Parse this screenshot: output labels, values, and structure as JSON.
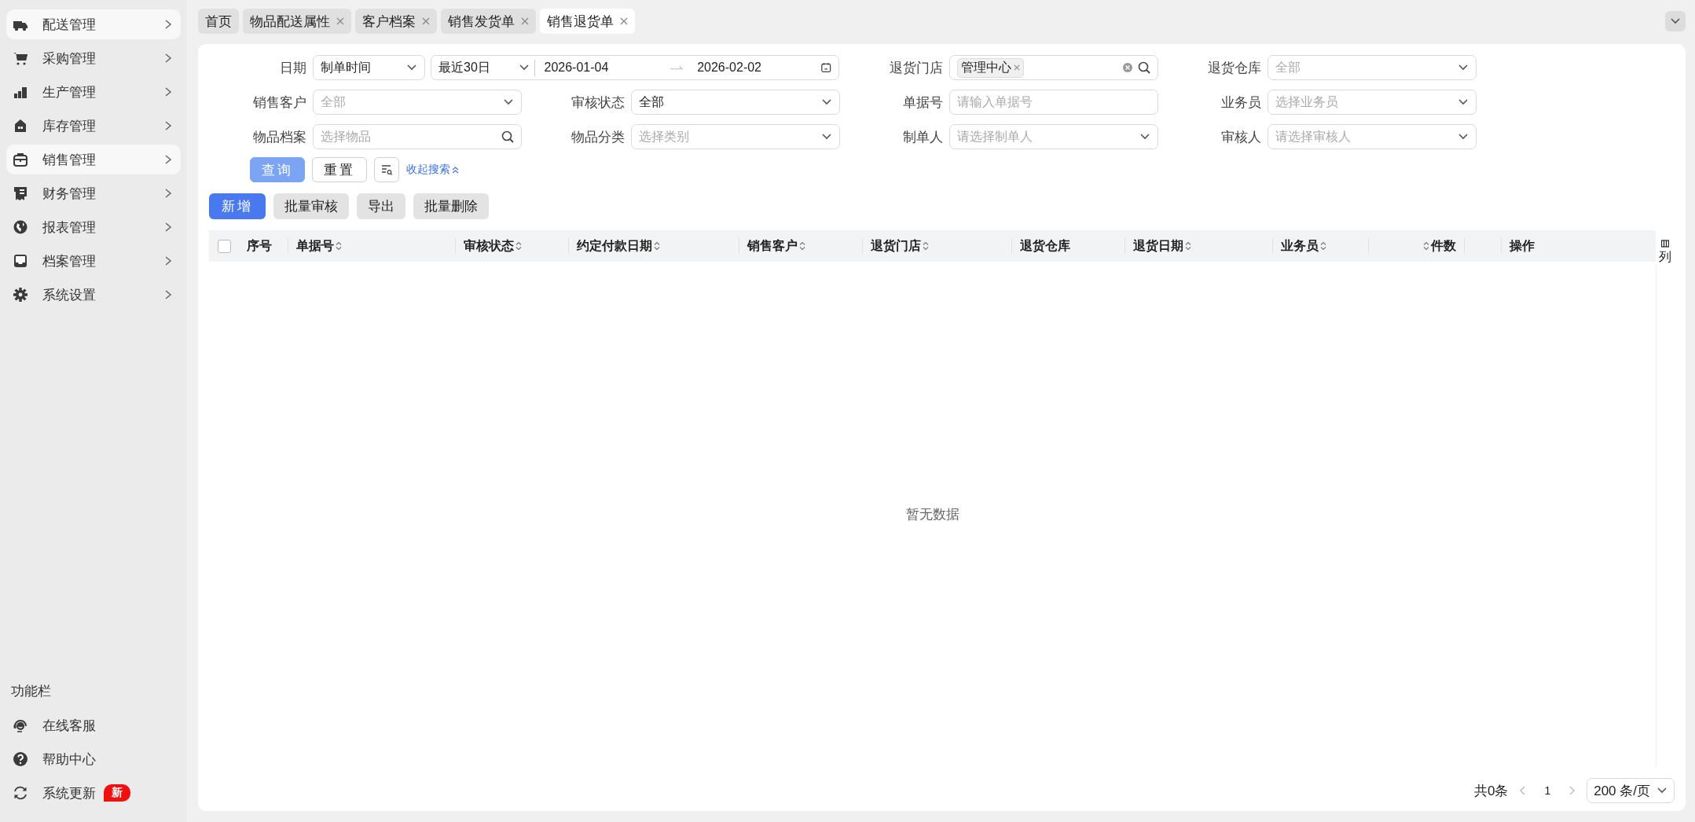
{
  "sidebar": {
    "items": [
      {
        "label": "配送管理",
        "selected": true
      },
      {
        "label": "采购管理",
        "selected": false
      },
      {
        "label": "生产管理",
        "selected": false
      },
      {
        "label": "库存管理",
        "selected": false
      },
      {
        "label": "销售管理",
        "selected": true
      },
      {
        "label": "财务管理",
        "selected": false
      },
      {
        "label": "报表管理",
        "selected": false
      },
      {
        "label": "档案管理",
        "selected": false
      },
      {
        "label": "系统设置",
        "selected": false
      }
    ],
    "section_title": "功能栏",
    "tools": [
      {
        "label": "在线客服"
      },
      {
        "label": "帮助中心"
      },
      {
        "label": "系统更新",
        "badge": "新"
      }
    ]
  },
  "tabs": [
    {
      "label": "首页",
      "closable": false,
      "selected": false
    },
    {
      "label": "物品配送属性",
      "closable": true,
      "selected": false
    },
    {
      "label": "客户档案",
      "closable": true,
      "selected": false
    },
    {
      "label": "销售发货单",
      "closable": true,
      "selected": false
    },
    {
      "label": "销售退货单",
      "closable": true,
      "selected": true
    }
  ],
  "filters": [
    {
      "label": "日期",
      "kind": "daterange",
      "type_value": "制单时间",
      "preset": "最近30日",
      "start": "2026-01-04",
      "end": "2026-02-02"
    },
    {
      "label": "退货门店",
      "kind": "tags",
      "tags": [
        "管理中心"
      ]
    },
    {
      "label": "退货仓库",
      "kind": "select",
      "placeholder": "全部"
    },
    {
      "label": "销售客户",
      "kind": "select",
      "placeholder": "全部"
    },
    {
      "label": "审核状态",
      "kind": "select",
      "value": "全部"
    },
    {
      "label": "单据号",
      "kind": "text",
      "placeholder": "请输入单据号"
    },
    {
      "label": "业务员",
      "kind": "select",
      "placeholder": "选择业务员"
    },
    {
      "label": "物品档案",
      "kind": "search",
      "placeholder": "选择物品"
    },
    {
      "label": "物品分类",
      "kind": "select",
      "placeholder": "选择类别"
    },
    {
      "label": "制单人",
      "kind": "select",
      "placeholder": "请选择制单人"
    },
    {
      "label": "审核人",
      "kind": "select",
      "placeholder": "请选择审核人"
    }
  ],
  "query_buttons": {
    "query": "查询",
    "reset": "重置",
    "collapse_link": "收起搜索"
  },
  "toolbar": [
    {
      "label": "新增",
      "primary": true
    },
    {
      "label": "批量审核",
      "primary": false
    },
    {
      "label": "导出",
      "primary": false
    },
    {
      "label": "批量删除",
      "primary": false
    }
  ],
  "table": {
    "select_all": {
      "checked": false
    },
    "columns": [
      {
        "label": "序号",
        "sortable": false
      },
      {
        "label": "单据号",
        "sortable": true
      },
      {
        "label": "审核状态",
        "sortable": true
      },
      {
        "label": "约定付款日期",
        "sortable": true
      },
      {
        "label": "销售客户",
        "sortable": true
      },
      {
        "label": "退货门店",
        "sortable": true
      },
      {
        "label": "退货仓库",
        "sortable": false
      },
      {
        "label": "退货日期",
        "sortable": true
      },
      {
        "label": "业务员",
        "sortable": true
      },
      {
        "label": "件数",
        "sortable": true
      },
      {
        "label": "操作",
        "sortable": false
      }
    ],
    "empty_text": "暂无数据",
    "column_settings": "列"
  },
  "pagination": {
    "total": "共0条",
    "page": "1",
    "page_size": "200 条/页"
  }
}
